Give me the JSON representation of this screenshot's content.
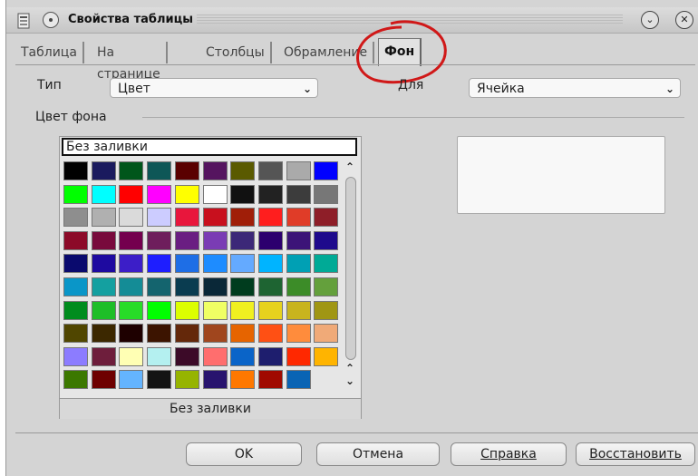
{
  "window": {
    "title": "Свойства таблицы"
  },
  "tabs": [
    {
      "label": "Таблица"
    },
    {
      "label": "На странице"
    },
    {
      "label": "Столбцы"
    },
    {
      "label": "Обрамление"
    },
    {
      "label": "Фон",
      "active": true
    }
  ],
  "form": {
    "type_label": "Тип",
    "type_value": "Цвет",
    "for_label": "Для",
    "for_value": "Ячейка",
    "group_label": "Цвет фона"
  },
  "palette": {
    "no_fill_top": "Без заливки",
    "no_fill_bottom": "Без заливки",
    "colors": [
      [
        "#000000",
        "#1a1a5e",
        "#00561b",
        "#0e5757",
        "#5a0000",
        "#55145f",
        "#5a5a00",
        "#555555",
        "#aaaaaa",
        "#0000ff"
      ],
      [
        "#00ff00",
        "#00ffff",
        "#ff0000",
        "#ff00ff",
        "#ffff00",
        "#ffffff",
        "#111111",
        "#222222",
        "#3c3c3c",
        "#777777"
      ],
      [
        "#8e8e8e",
        "#b0b0b0",
        "#dadada",
        "#ccccff",
        "#e8163c",
        "#c8101e",
        "#a01e08",
        "#ff1e1e",
        "#e03c28",
        "#8e1e28"
      ],
      [
        "#8c0a28",
        "#780a3c",
        "#74004e",
        "#6e1e5c",
        "#6a1e82",
        "#7a3cb4",
        "#3c2878",
        "#2c006e",
        "#3c1478",
        "#1e0a8c"
      ],
      [
        "#0a0a6e",
        "#1e0aa0",
        "#3c1ec8",
        "#1e1eff",
        "#1e6ee6",
        "#1e8cff",
        "#64aaff",
        "#00b4ff",
        "#00a0b4",
        "#00aa96"
      ],
      [
        "#0a96c8",
        "#14a0a0",
        "#148c96",
        "#14646e",
        "#0a3c50",
        "#0a2838",
        "#003c1e",
        "#1e6432",
        "#3c8c28",
        "#64a03c"
      ],
      [
        "#008c1e",
        "#1ebe28",
        "#28dc28",
        "#00ff00",
        "#dcff00",
        "#f0ff64",
        "#f0f020",
        "#e6d21e",
        "#c8b41e",
        "#a09614"
      ],
      [
        "#504600",
        "#3c2800",
        "#1e0000",
        "#3c1400",
        "#64280a",
        "#a0461e",
        "#e66400",
        "#ff5014",
        "#ff8c3c",
        "#f0aa78"
      ],
      [
        "#8c7cff",
        "#6e1e3c",
        "#ffffb4",
        "#b4f0f0",
        "#3c0a28",
        "#ff6e6e",
        "#0a64c8",
        "#1e1e6e",
        "#ff2800",
        "#ffb400"
      ],
      [
        "#3c7800",
        "#6e0000",
        "#64b4ff",
        "#141414",
        "#96b400",
        "#28146e",
        "#ff7800",
        "#a00a00",
        "#0a64b4"
      ]
    ]
  },
  "buttons": {
    "ok": "OK",
    "cancel": "Отмена",
    "help": "Справка",
    "reset": "Восстановить"
  }
}
